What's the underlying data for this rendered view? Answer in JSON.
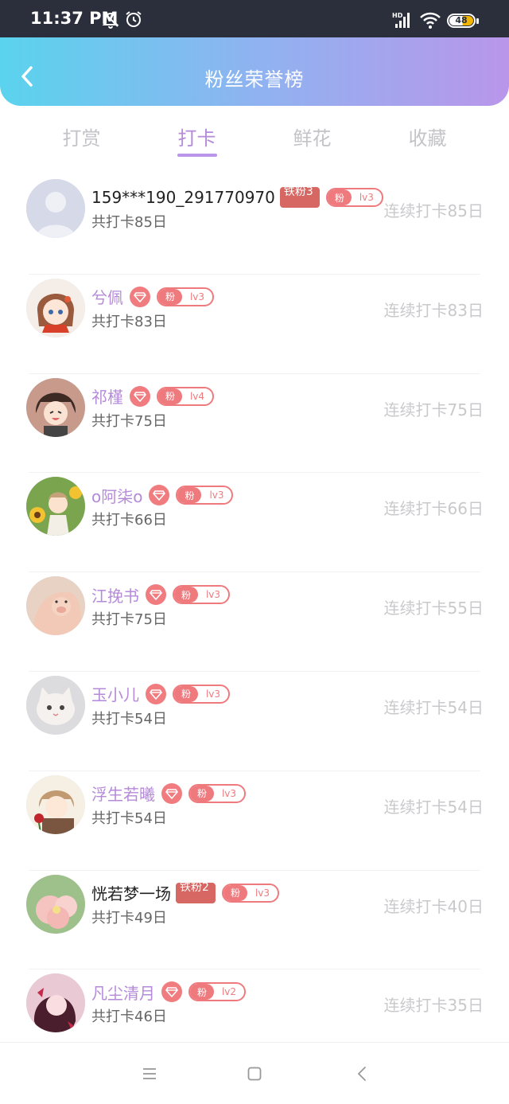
{
  "status_bar": {
    "time": "11:37 PM",
    "battery_text": "48",
    "icons": [
      "bell-off-icon",
      "alarm-icon",
      "signal-icon",
      "wifi-icon",
      "battery-icon"
    ]
  },
  "header": {
    "title": "粉丝荣誉榜",
    "back_icon": "chevron-left-icon"
  },
  "tabs": [
    {
      "label": "打赏",
      "active": false
    },
    {
      "label": "打卡",
      "active": true
    },
    {
      "label": "鲜花",
      "active": false
    },
    {
      "label": "收藏",
      "active": false
    }
  ],
  "colors": {
    "accent": "#b58ad9",
    "badge_red": "#ef7a7e",
    "iron_badge": "#d66762"
  },
  "fans": [
    {
      "name": "159***190_291770970",
      "name_style": "plain",
      "badge": "iron",
      "iron_label": "铁粉3",
      "fan_label": "粉",
      "level": "lv3",
      "total": "共打卡85日",
      "streak": "连续打卡85日",
      "avatar": "default-avatar"
    },
    {
      "name": "兮佩",
      "name_style": "vip",
      "badge": "vip",
      "fan_label": "粉",
      "level": "lv3",
      "total": "共打卡83日",
      "streak": "连续打卡83日",
      "avatar": "anime-girl-avatar"
    },
    {
      "name": "祁槿",
      "name_style": "vip",
      "badge": "vip",
      "fan_label": "粉",
      "level": "lv4",
      "total": "共打卡75日",
      "streak": "连续打卡75日",
      "avatar": "anime-boy-avatar"
    },
    {
      "name": "o阿柒o",
      "name_style": "vip",
      "badge": "vip",
      "fan_label": "粉",
      "level": "lv3",
      "total": "共打卡66日",
      "streak": "连续打卡66日",
      "avatar": "sunflower-avatar"
    },
    {
      "name": "江挽书",
      "name_style": "vip",
      "badge": "vip",
      "fan_label": "粉",
      "level": "lv3",
      "total": "共打卡75日",
      "streak": "连续打卡55日",
      "avatar": "pig-avatar"
    },
    {
      "name": "玉小儿",
      "name_style": "vip",
      "badge": "vip",
      "fan_label": "粉",
      "level": "lv3",
      "total": "共打卡54日",
      "streak": "连续打卡54日",
      "avatar": "kitten-avatar"
    },
    {
      "name": "浮生若曦",
      "name_style": "vip",
      "badge": "vip",
      "fan_label": "粉",
      "level": "lv3",
      "total": "共打卡54日",
      "streak": "连续打卡54日",
      "avatar": "anime-rose-avatar"
    },
    {
      "name": "恍若梦一场",
      "name_style": "plain",
      "badge": "iron",
      "iron_label": "铁粉2",
      "fan_label": "粉",
      "level": "lv3",
      "total": "共打卡49日",
      "streak": "连续打卡40日",
      "avatar": "flower-avatar"
    },
    {
      "name": "凡尘清月",
      "name_style": "vip",
      "badge": "vip",
      "fan_label": "粉",
      "level": "lv2",
      "total": "共打卡46日",
      "streak": "连续打卡35日",
      "avatar": "anime-dark-avatar"
    }
  ],
  "nav_bar": {
    "icons": [
      "menu-icon",
      "home-square-icon",
      "back-triangle-icon"
    ]
  }
}
